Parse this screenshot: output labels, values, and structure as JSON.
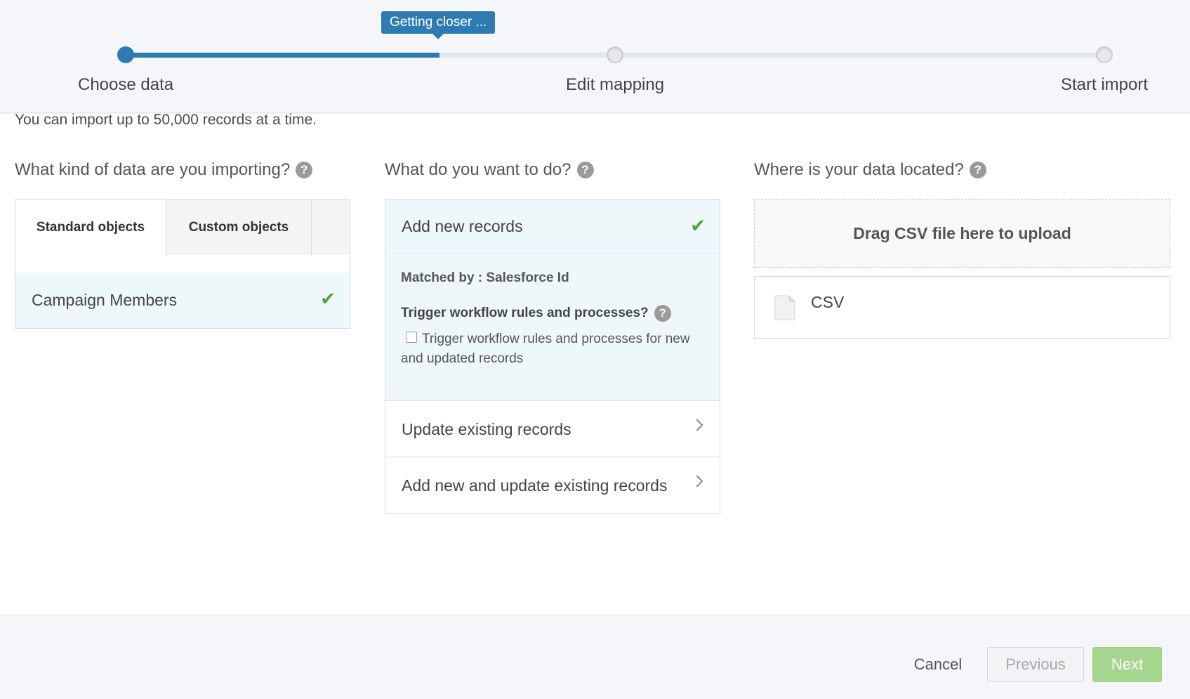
{
  "progress": {
    "tooltip": "Getting closer ...",
    "percent_complete": 32,
    "steps": [
      {
        "label": "Choose data",
        "state": "active"
      },
      {
        "label": "Edit mapping",
        "state": "pending"
      },
      {
        "label": "Start import",
        "state": "pending"
      }
    ]
  },
  "intro": {
    "limit_text": "You can import up to 50,000 records at a time."
  },
  "data_type": {
    "title": "What kind of data are you importing?",
    "help_icon": "?",
    "tabs": [
      {
        "label": "Standard objects",
        "selected": true
      },
      {
        "label": "Custom objects",
        "selected": false
      }
    ],
    "items": [
      {
        "label": "Campaign Members",
        "selected": true
      }
    ]
  },
  "action": {
    "title": "What do you want to do?",
    "help_icon": "?",
    "selected": {
      "label": "Add new records",
      "matched_by": "Matched by : Salesforce Id",
      "trigger_title": "Trigger workflow rules and processes?",
      "trigger_checkbox_label": "Trigger workflow rules and processes for new and updated records",
      "trigger_checked": false
    },
    "options": [
      {
        "label": "Update existing records"
      },
      {
        "label": "Add new and update existing records"
      }
    ]
  },
  "source": {
    "title": "Where is your data located?",
    "help_icon": "?",
    "dropzone": "Drag CSV file here to upload",
    "items": [
      {
        "label": "CSV",
        "icon": "file-icon"
      }
    ]
  },
  "footer": {
    "cancel": "Cancel",
    "previous": "Previous",
    "next": "Next"
  },
  "colors": {
    "accent": "#2e7bb4",
    "check": "#4fa33c",
    "selected_bg": "#eef8fb",
    "next_button": "#a8d58f"
  }
}
